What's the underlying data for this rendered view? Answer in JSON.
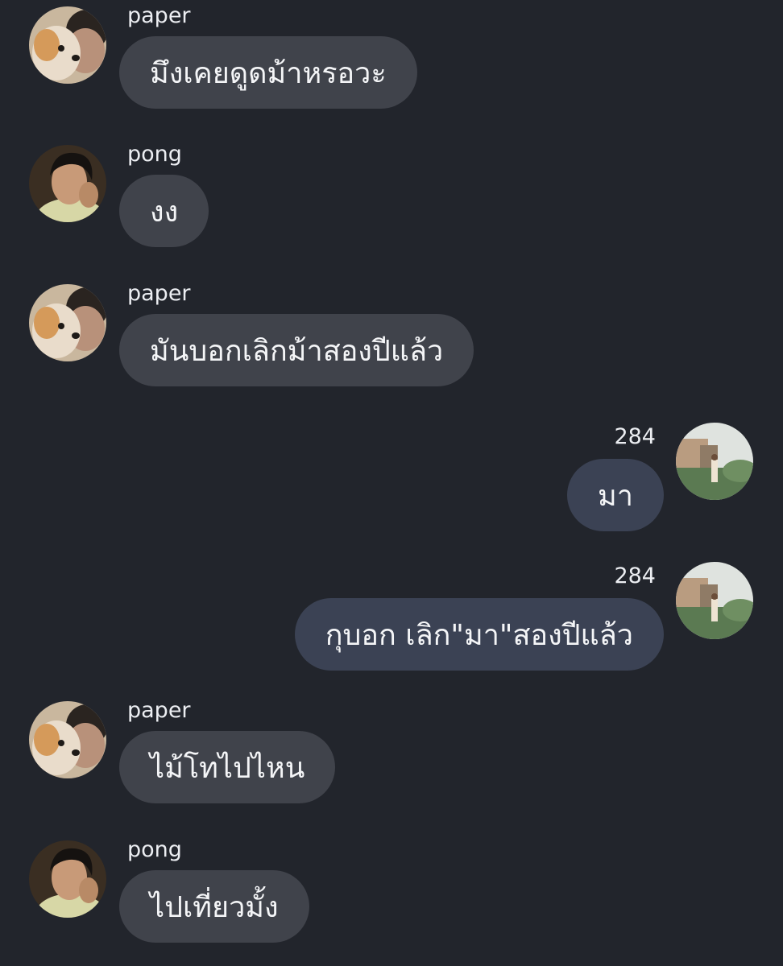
{
  "messages": [
    {
      "sender": "paper",
      "text": "มึงเคยดูดม้าหรอวะ",
      "side": "incoming",
      "avatar": "dog-and-person-avatar"
    },
    {
      "sender": "pong",
      "text": "งง",
      "side": "incoming",
      "avatar": "person-portrait-avatar"
    },
    {
      "sender": "paper",
      "text": "มันบอกเลิกม้าสองปีแล้ว",
      "side": "incoming",
      "avatar": "dog-and-person-avatar"
    },
    {
      "sender": "284",
      "text": "มา",
      "side": "outgoing",
      "avatar": "outdoor-scene-avatar"
    },
    {
      "sender": "284",
      "text": "กุบอก เลิก\"มา\"สองปีแล้ว",
      "side": "outgoing",
      "avatar": "outdoor-scene-avatar"
    },
    {
      "sender": "paper",
      "text": "ไม้โทไปไหน",
      "side": "incoming",
      "avatar": "dog-and-person-avatar"
    },
    {
      "sender": "pong",
      "text": "ไปเที่ยวมั้ง",
      "side": "incoming",
      "avatar": "person-portrait-avatar"
    }
  ],
  "colors": {
    "background": "#22252c",
    "incoming_bubble": "#40434b",
    "outgoing_bubble": "#3b4254",
    "text": "#f4f5f7"
  }
}
